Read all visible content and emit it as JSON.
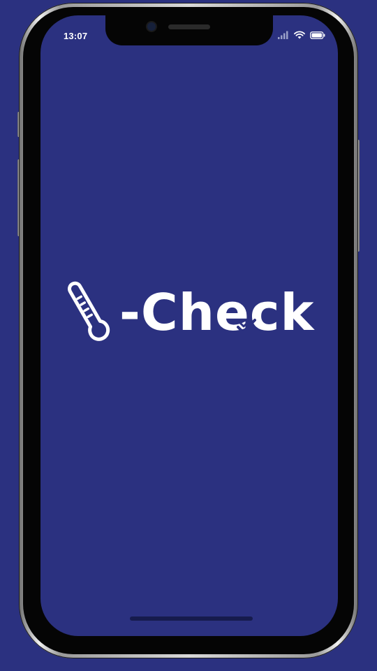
{
  "status_bar": {
    "time": "13:07"
  },
  "splash": {
    "logo_text": "-Check",
    "logo_icon": "thermometer-icon",
    "checkmark_icon": "check-badge-icon"
  },
  "colors": {
    "background": "#2b3180",
    "logo": "#ffffff"
  }
}
